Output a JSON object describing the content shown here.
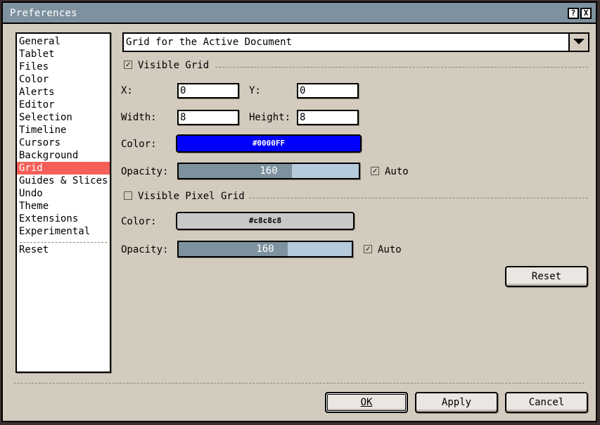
{
  "window": {
    "title": "Preferences",
    "help_label": "?",
    "close_label": "X"
  },
  "sidebar": {
    "items": [
      {
        "label": "General"
      },
      {
        "label": "Tablet"
      },
      {
        "label": "Files"
      },
      {
        "label": "Color"
      },
      {
        "label": "Alerts"
      },
      {
        "label": "Editor"
      },
      {
        "label": "Selection"
      },
      {
        "label": "Timeline"
      },
      {
        "label": "Cursors"
      },
      {
        "label": "Background"
      },
      {
        "label": "Grid"
      },
      {
        "label": "Guides & Slices"
      },
      {
        "label": "Undo"
      },
      {
        "label": "Theme"
      },
      {
        "label": "Extensions"
      },
      {
        "label": "Experimental"
      }
    ],
    "active": "Grid",
    "reset_label": "Reset"
  },
  "grid": {
    "scope": "Grid for the Active Document",
    "visible_grid": {
      "label": "Visible Grid",
      "checked": true
    },
    "x_label": "X:",
    "x_value": "0",
    "y_label": "Y:",
    "y_value": "0",
    "width_label": "Width:",
    "width_value": "8",
    "height_label": "Height:",
    "height_value": "8",
    "color_label": "Color:",
    "color_value": "#0000FF",
    "opacity_label": "Opacity:",
    "opacity_value": "160",
    "opacity_fraction": 0.63,
    "auto_label": "Auto",
    "auto_checked": true
  },
  "pixel_grid": {
    "visible": {
      "label": "Visible Pixel Grid",
      "checked": false
    },
    "color_label": "Color:",
    "color_value": "#c8c8c8",
    "opacity_label": "Opacity:",
    "opacity_value": "160",
    "opacity_fraction": 0.63,
    "auto_label": "Auto",
    "auto_checked": true
  },
  "buttons": {
    "reset": "Reset",
    "ok": "OK",
    "apply": "Apply",
    "cancel": "Cancel"
  },
  "colors": {
    "grid_color": "#0000FF",
    "pixel_grid_color": "#c8c8c8",
    "accent_active": "#f55f58",
    "titlebar": "#7d929e"
  }
}
